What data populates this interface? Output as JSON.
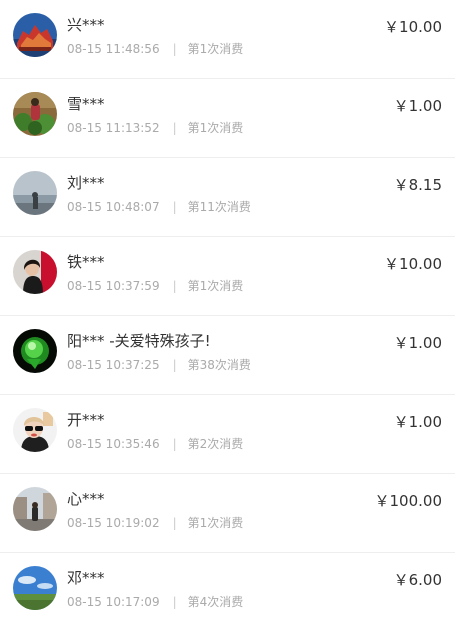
{
  "records": [
    {
      "name": "兴***",
      "time": "08-15 11:48:56",
      "count": "第1次消费",
      "amount": "￥10.00",
      "avatar_icon": "red-building-avatar-icon"
    },
    {
      "name": "雪***",
      "time": "08-15 11:13:52",
      "count": "第1次消费",
      "amount": "￥1.00",
      "avatar_icon": "green-garden-avatar-icon"
    },
    {
      "name": "刘***",
      "time": "08-15 10:48:07",
      "count": "第11次消费",
      "amount": "￥8.15",
      "avatar_icon": "sea-horizon-avatar-icon"
    },
    {
      "name": "铁***",
      "time": "08-15 10:37:59",
      "count": "第1次消费",
      "amount": "￥10.00",
      "avatar_icon": "woman-portrait-avatar-icon"
    },
    {
      "name": "阳*** -关爱特殊孩子!",
      "time": "08-15 10:37:25",
      "count": "第38次消费",
      "amount": "￥1.00",
      "avatar_icon": "green-glow-avatar-icon"
    },
    {
      "name": "开***",
      "time": "08-15 10:35:46",
      "count": "第2次消费",
      "amount": "￥1.00",
      "avatar_icon": "sunglasses-girl-avatar-icon"
    },
    {
      "name": "心***",
      "time": "08-15 10:19:02",
      "count": "第1次消费",
      "amount": "￥100.00",
      "avatar_icon": "street-person-avatar-icon"
    },
    {
      "name": "邓***",
      "time": "08-15 10:17:09",
      "count": "第4次消费",
      "amount": "￥6.00",
      "avatar_icon": "blue-sky-field-avatar-icon"
    }
  ],
  "separator": "|"
}
